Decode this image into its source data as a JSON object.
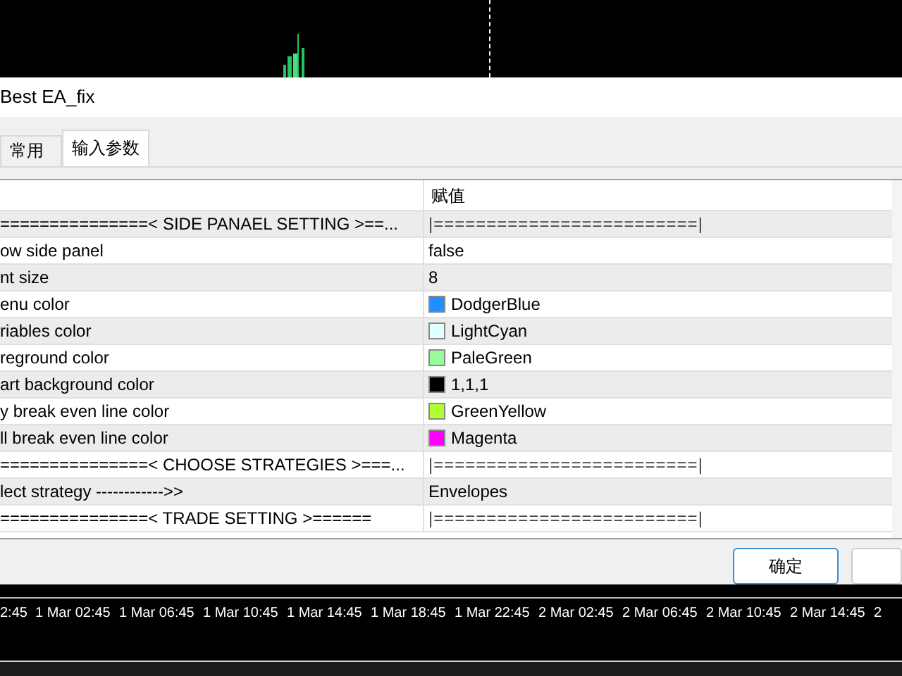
{
  "dialog": {
    "title": "Best EA_fix"
  },
  "tabs": [
    {
      "label": "常用",
      "selected": false
    },
    {
      "label": "输入参数",
      "selected": true
    }
  ],
  "table": {
    "columns": [
      "赋值"
    ],
    "rows": [
      {
        "kind": "separator",
        "name": "===============< SIDE PANAEL SETTING >==...",
        "value": "|=========================|"
      },
      {
        "kind": "text",
        "name": "ow side panel",
        "value": "false"
      },
      {
        "kind": "text",
        "name": "nt size",
        "value": "8"
      },
      {
        "kind": "color",
        "name": "enu color",
        "value": "DodgerBlue",
        "color": "#1e90ff"
      },
      {
        "kind": "color",
        "name": "riables color",
        "value": "LightCyan",
        "color": "#e0ffff"
      },
      {
        "kind": "color",
        "name": "reground color",
        "value": "PaleGreen",
        "color": "#98fb98"
      },
      {
        "kind": "color",
        "name": "art background color",
        "value": "1,1,1",
        "color": "#010101"
      },
      {
        "kind": "color",
        "name": "y break even line color",
        "value": "GreenYellow",
        "color": "#adff2f"
      },
      {
        "kind": "color",
        "name": "ll break even line color",
        "value": "Magenta",
        "color": "#ff00ff"
      },
      {
        "kind": "separator",
        "name": "===============< CHOOSE STRATEGIES >===...",
        "value": "|=========================|"
      },
      {
        "kind": "text",
        "name": "lect strategy ------------>>",
        "value": "Envelopes"
      },
      {
        "kind": "separator",
        "name": "===============< TRADE SETTING >======",
        "value": "|=========================|"
      }
    ]
  },
  "buttons": [
    "确定"
  ],
  "time_axis": [
    "2:45",
    "1 Mar 02:45",
    "1 Mar 06:45",
    "1 Mar 10:45",
    "1 Mar 14:45",
    "1 Mar 18:45",
    "1 Mar 22:45",
    "2 Mar 02:45",
    "2 Mar 06:45",
    "2 Mar 10:45",
    "2 Mar 14:45",
    "2"
  ]
}
